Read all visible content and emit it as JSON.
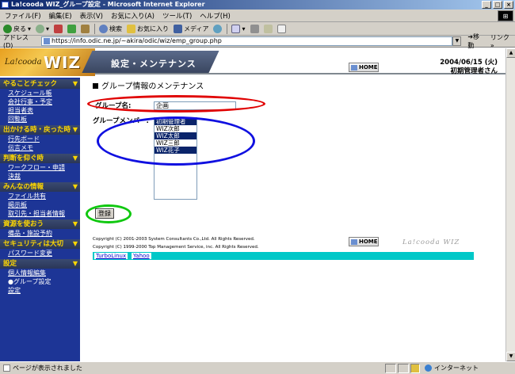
{
  "window": {
    "title": "La!cooda WIZ_グループ設定 - Microsoft Internet Explorer"
  },
  "menubar": {
    "items": [
      "ファイル(F)",
      "編集(E)",
      "表示(V)",
      "お気に入り(A)",
      "ツール(T)",
      "ヘルプ(H)"
    ]
  },
  "toolbar": {
    "back": "戻る",
    "search": "検索",
    "favorites": "お気に入り",
    "media": "メディア"
  },
  "addressbar": {
    "label": "アドレス(D)",
    "url": "https://info.odic.ne.jp/~akira/odic/wiz/emp_group.php",
    "go": "移動",
    "links": "リンク"
  },
  "header": {
    "logo_small": "La!cooda",
    "logo_big": "WIZ",
    "section": "設定・メンテナンス",
    "home": "HOME",
    "date": "2004/06/15 (火)",
    "user": "初期管理者さん"
  },
  "sidebar": {
    "sections": [
      {
        "title": "やることチェック",
        "items": [
          "スケジュール帳",
          "会社行事・予定",
          "担当者表",
          "回覧板"
        ]
      },
      {
        "title": "出かける時・戻った時",
        "items": [
          "行先ボード",
          "伝言メモ"
        ]
      },
      {
        "title": "判断を仰ぐ時",
        "items": [
          "ワークフロー・申請",
          "決裁"
        ]
      },
      {
        "title": "みんなの情報",
        "items": [
          "ファイル共有",
          "掲示板",
          "取引先・担当者情報"
        ]
      },
      {
        "title": "資源を使おう",
        "items": [
          "備品・施設予約"
        ]
      },
      {
        "title": "セキュリティは大切",
        "items": [
          "パスワード変更"
        ]
      },
      {
        "title": "設定",
        "items": [
          "個人情報編集",
          "●グループ設定",
          "設定"
        ]
      }
    ]
  },
  "main": {
    "title": "グループ情報のメンテナンス",
    "group_name_label": "グループ名:",
    "group_name_value": "企画",
    "members_label": "グループメンバー:",
    "members": [
      {
        "name": "初期管理者",
        "selected": true
      },
      {
        "name": "WIZ次郎",
        "selected": false
      },
      {
        "name": "WIZ太郎",
        "selected": true
      },
      {
        "name": "WIZ三郎",
        "selected": false
      },
      {
        "name": "WIZ花子",
        "selected": true
      }
    ],
    "register_button": "登録"
  },
  "footer": {
    "copyright1": "Copyright (C) 2001-2003 System Consultants Co.,Ltd. All Rights Reserved.",
    "copyright2": "Copyright (C) 1999-2000 Top Management Service, inc. All Rights Reserved.",
    "home": "HOME",
    "logo": "La!cooda WIZ",
    "links": [
      "TurboLinux",
      "Yahoo"
    ]
  },
  "statusbar": {
    "text": "ページが表示されました",
    "zone": "インターネット"
  },
  "colors": {
    "sidebar_bg": "#1d3596",
    "sidebar_heading": "#ffd700",
    "annotation_red": "#e00000",
    "annotation_blue": "#1010e0",
    "annotation_green": "#10c810",
    "footer_bar": "#00c8c8"
  }
}
